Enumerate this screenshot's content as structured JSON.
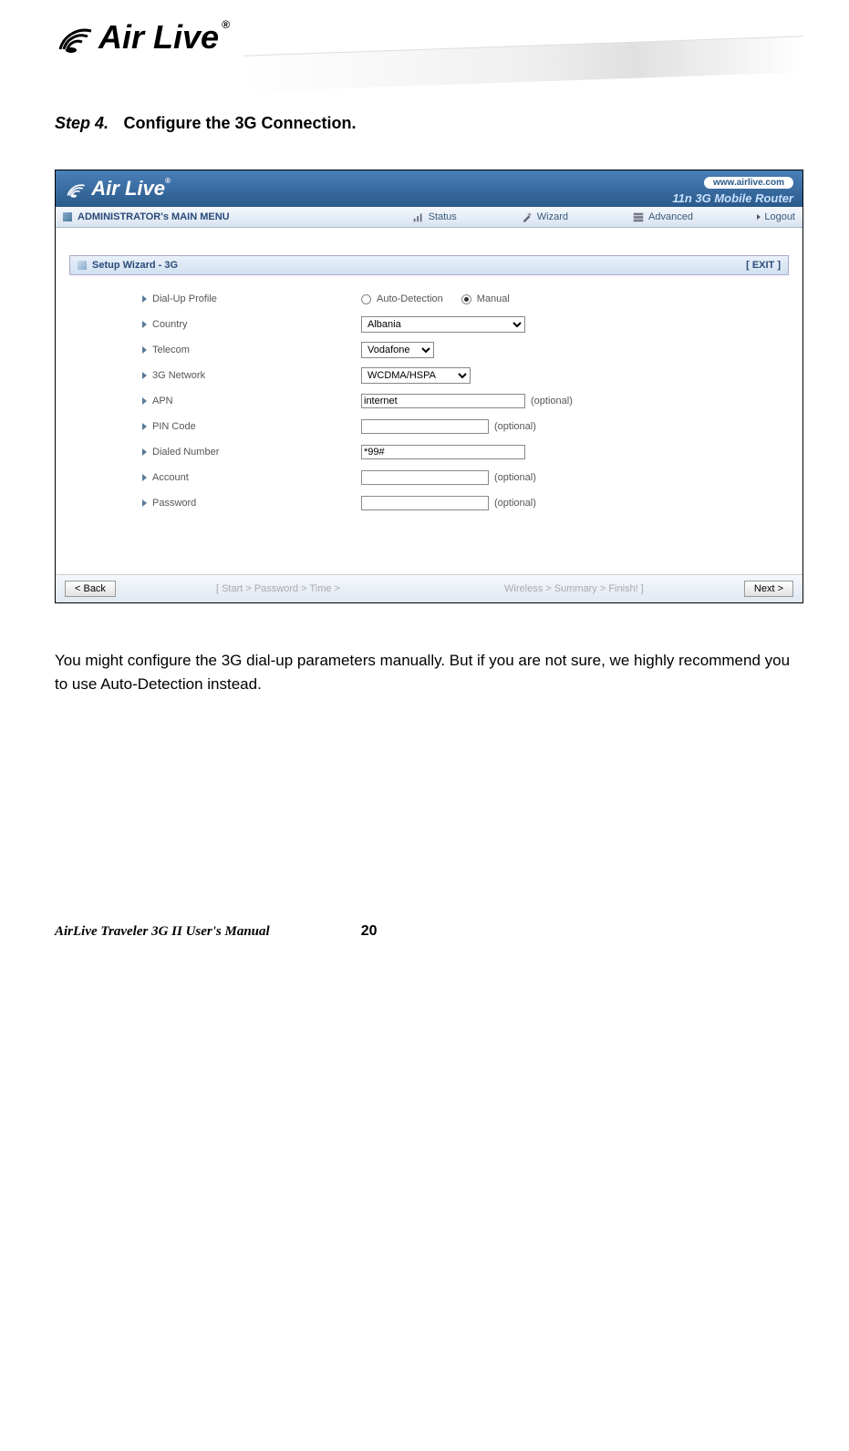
{
  "logo": {
    "text": "Air Live"
  },
  "step": {
    "num": "Step 4.",
    "title": "Configure the 3G Connection."
  },
  "router": {
    "logo": "Air Live",
    "url": "www.airlive.com",
    "subtitle": "11n 3G Mobile Router",
    "menu": {
      "main": "ADMINISTRATOR's MAIN MENU",
      "status": "Status",
      "wizard": "Wizard",
      "advanced": "Advanced",
      "logout": "Logout"
    },
    "panel": {
      "title": "Setup Wizard - 3G",
      "exit": "[ EXIT ]"
    },
    "form": {
      "dialup_label": "Dial-Up Profile",
      "auto_label": "Auto-Detection",
      "manual_label": "Manual",
      "country_label": "Country",
      "country_value": "Albania",
      "telecom_label": "Telecom",
      "telecom_value": "Vodafone",
      "network_label": "3G Network",
      "network_value": "WCDMA/HSPA",
      "apn_label": "APN",
      "apn_value": "internet",
      "pin_label": "PIN Code",
      "pin_value": "",
      "dialed_label": "Dialed Number",
      "dialed_value": "*99#",
      "account_label": "Account",
      "account_value": "",
      "password_label": "Password",
      "password_value": "",
      "optional": "(optional)"
    },
    "footer": {
      "back": "< Back",
      "crumb1": "[ Start > Password > Time >",
      "crumb2": "Wireless > Summary > Finish! ]",
      "next": "Next >"
    }
  },
  "body_text": "You might configure the 3G dial-up parameters manually. But if you are not sure, we highly recommend you to use Auto-Detection instead.",
  "doc_footer": {
    "manual": "AirLive Traveler 3G II User's Manual",
    "page": "20"
  }
}
